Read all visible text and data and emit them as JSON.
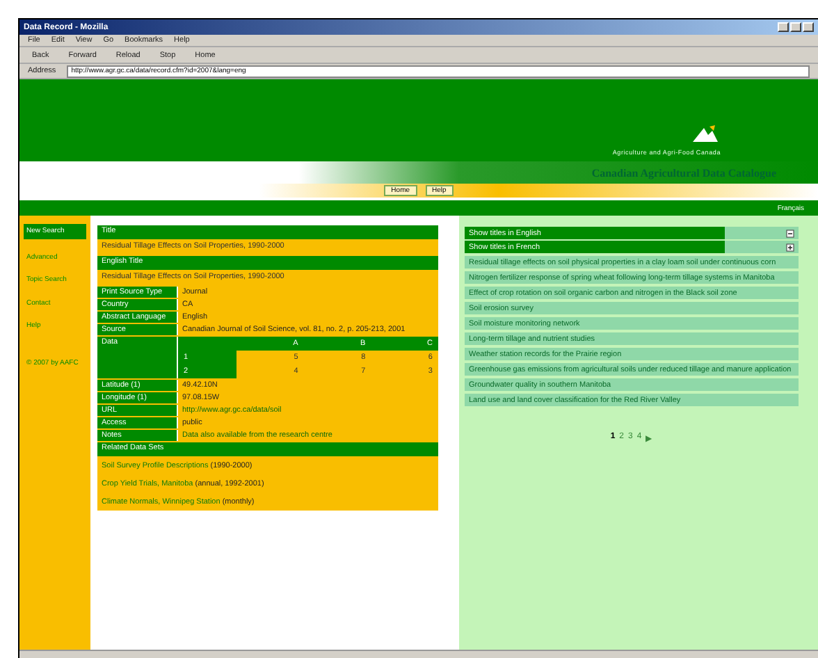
{
  "browser": {
    "title": "Data Record - Mozilla",
    "menu": [
      "File",
      "Edit",
      "View",
      "Go",
      "Bookmarks",
      "Help"
    ],
    "toolbar": [
      "Back",
      "Forward",
      "Reload",
      "Stop",
      "Home"
    ],
    "address_label": "Address",
    "address": "http://www.agr.gc.ca/data/record.cfm?id=2007&lang=eng"
  },
  "header": {
    "tagline": "Agriculture and Agri-Food Canada",
    "title": "Canadian Agricultural Data Catalogue",
    "nav": [
      "Home",
      "Help"
    ],
    "language": "Français"
  },
  "sidebar": {
    "items": [
      {
        "label": "New Search",
        "selected": true
      },
      {
        "label": "Advanced",
        "selected": false
      },
      {
        "label": "Topic Search",
        "selected": false
      },
      {
        "label": "Contact",
        "selected": false
      },
      {
        "label": "Help",
        "selected": false
      }
    ],
    "note": "© 2007 by AAFC"
  },
  "record": {
    "rows": [
      {
        "kind": "heading",
        "text": "Title"
      },
      {
        "kind": "full",
        "text": "Residual Tillage Effects on Soil Properties, 1990-2000"
      },
      {
        "kind": "heading",
        "text": "English Title"
      },
      {
        "kind": "full",
        "text": "Residual Tillage Effects on Soil Properties, 1990-2000"
      },
      {
        "kind": "field",
        "label": "Print Source Type",
        "value": "Journal"
      },
      {
        "kind": "field",
        "label": "Country",
        "value": "CA"
      },
      {
        "kind": "field",
        "label": "Abstract Language",
        "value": "English"
      },
      {
        "kind": "field",
        "label": "Source",
        "value": "Canadian Journal of Soil Science, vol. 81, no. 2, p. 205-213, 2001"
      },
      {
        "kind": "matrix",
        "label": "Data",
        "header": [
          "A",
          "B",
          "C"
        ],
        "rows": [
          [
            "1",
            "5",
            "8",
            "6"
          ],
          [
            "2",
            "4",
            "7",
            "3"
          ]
        ]
      },
      {
        "kind": "field",
        "label": "Latitude (1)",
        "value": "49.42.10N"
      },
      {
        "kind": "field",
        "label": "Longitude (1)",
        "value": "97.08.15W"
      },
      {
        "kind": "link_field",
        "label": "URL",
        "value": "http://www.agr.gc.ca/data/soil"
      },
      {
        "kind": "field",
        "label": "Access",
        "value": "public"
      },
      {
        "kind": "link_field",
        "label": "Notes",
        "value": "Data also available from the research centre"
      },
      {
        "kind": "heading",
        "text": "Related Data Sets"
      },
      {
        "kind": "link",
        "link": "Soil Survey Profile Descriptions",
        "rest": "(1990-2000)"
      },
      {
        "kind": "link",
        "link": "Crop Yield Trials, Manitoba",
        "rest": "(annual, 1992-2001)"
      },
      {
        "kind": "link",
        "link": "Climate Normals, Winnipeg Station",
        "rest": "(monthly)"
      }
    ]
  },
  "results": {
    "headers": [
      {
        "text": "Show titles in English",
        "expanded": true
      },
      {
        "text": "Show titles in French",
        "expanded": false
      }
    ],
    "items": [
      "Residual tillage effects on soil physical properties in a clay loam soil under continuous corn",
      "Nitrogen fertilizer response of spring wheat following long-term tillage systems in Manitoba",
      "Effect of crop rotation on soil organic carbon and nitrogen in the Black soil zone",
      "Soil erosion survey",
      "Soil moisture monitoring network",
      "Long-term tillage and nutrient studies",
      "Weather station records for the Prairie region",
      "Greenhouse gas emissions from agricultural soils under reduced tillage and manure application",
      "Groundwater quality in southern Manitoba",
      "Land use and land cover classification for the Red River Valley"
    ],
    "pages": [
      {
        "label": "1",
        "selected": true
      },
      {
        "label": "2",
        "selected": false
      },
      {
        "label": "3",
        "selected": false
      },
      {
        "label": "4",
        "selected": false
      }
    ],
    "next": "▶"
  }
}
